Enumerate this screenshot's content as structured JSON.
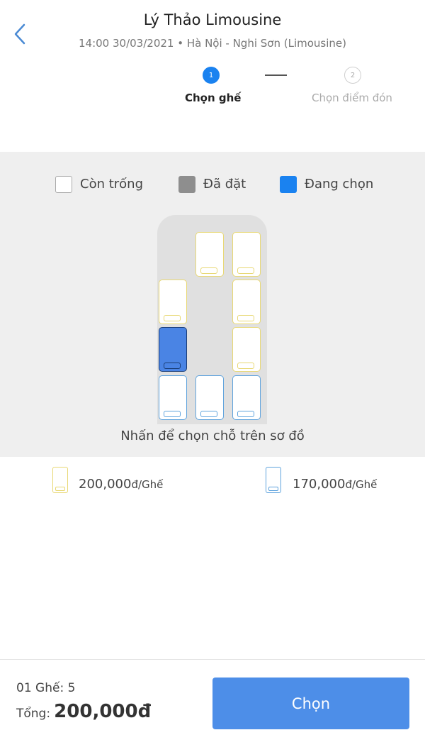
{
  "header": {
    "title": "Lý Thảo Limousine",
    "subtitle": "14:00 30/03/2021 • Hà Nội - Nghi Sơn (Limousine)"
  },
  "steps": [
    {
      "number": "1",
      "label": "Chọn ghế",
      "active": true
    },
    {
      "number": "2",
      "label": "Chọn điểm đón",
      "active": false
    }
  ],
  "legend": {
    "empty": "Còn trống",
    "booked": "Đã đặt",
    "selected": "Đang chọn"
  },
  "hint": "Nhấn để chọn chỗ trên sơ đồ",
  "prices": [
    {
      "amount": "200,000",
      "unit": "đ/Ghế",
      "type": "vip",
      "color": "#e8d874"
    },
    {
      "amount": "170,000",
      "unit": "đ/Ghế",
      "type": "standard",
      "color": "#5fa3dd"
    }
  ],
  "seat_map": {
    "vip_color": "#e8d874",
    "standard_color": "#5fa3dd",
    "selected_color": "#4a84e4"
  },
  "footer": {
    "count_text": "01 Ghế: 5",
    "total_label": "Tổng:",
    "total_value": "200,000đ",
    "button_label": "Chọn"
  },
  "colors": {
    "accent": "#1a82f0",
    "button": "#4d8ee8"
  }
}
